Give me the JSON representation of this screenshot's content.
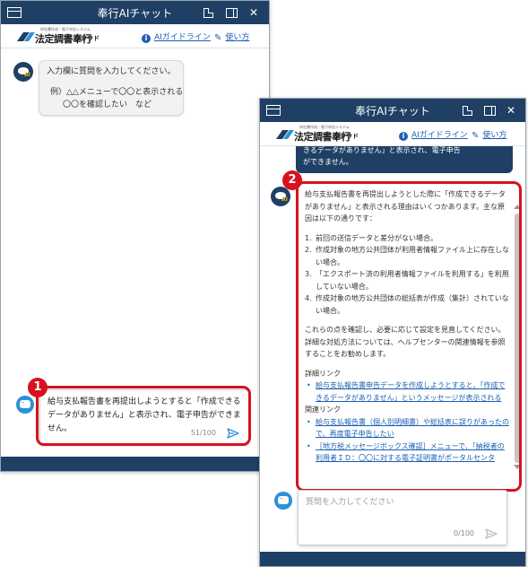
{
  "window1": {
    "title": "奉行AIチャット",
    "logo": {
      "sub": "申告書作成・電子申告システム",
      "main": "法定調書奉行",
      "cloud": "クラウド"
    },
    "links": {
      "guideline": "AIガイドライン",
      "howto": "使い方"
    },
    "bot_message": {
      "line1": "入力欄に質問を入力してください。",
      "line2": "例）△△メニューで〇〇と表示される",
      "line3": "〇〇を確認したい　など"
    },
    "composer": {
      "text": "給与支払報告書を再提出しようとすると「作成できるデータがありません」と表示され、電子申告ができません。",
      "counter": "51/100"
    },
    "badge": "1"
  },
  "window2": {
    "title": "奉行AIチャット",
    "logo": {
      "sub": "申告書作成・電子申告システム",
      "main": "法定調書奉行",
      "cloud": "クラウド"
    },
    "links": {
      "guideline": "AIガイドライン",
      "howto": "使い方"
    },
    "user_bubble_partial": {
      "line1": "きるデータがありません」と表示され、電子申告",
      "line2": "ができません。"
    },
    "answer": {
      "intro": "給与支払報告書を再提出しようとした際に「作成できるデータがありません」と表示される理由はいくつかあります。主な原因は以下の通りです：",
      "reasons": [
        {
          "n": "1.",
          "text": "前回の送信データと差分がない場合。"
        },
        {
          "n": "2.",
          "text": "作成対象の地方公共団体が利用者情報ファイル上に存在しない場合。"
        },
        {
          "n": "3.",
          "text": "「エクスポート済の利用者情報ファイルを利用する」を利用していない場合。"
        },
        {
          "n": "4.",
          "text": "作成対象の地方公共団体の総括表が作成（集計）されていない場合。"
        }
      ],
      "closing": "これらの点を確認し、必要に応じて設定を見直してください。詳細な対処方法については、ヘルプセンターの関連情報を参照することをお勧めします。",
      "detail_heading": "詳細リンク",
      "detail_link": "給与支払報告書申告データを作成しようとすると、「作成できるデータがありません」というメッセージが表示される",
      "related_heading": "関連リンク",
      "related_links": [
        "給与支払報告書（個人別明細書）や総括表に誤りがあったので、再度電子申告したい",
        "［地方税メッセージボックス確認］メニューで、「納税者の利用者ＩＤ：〇〇に対する電子証明書がポータルセンタ"
      ]
    },
    "composer": {
      "placeholder": "質問を入力してください",
      "counter": "0/100"
    },
    "badge": "2"
  },
  "colors": {
    "titlebar": "#1f3f64",
    "link": "#1a5fb4",
    "highlight": "#d8111e",
    "user_avatar": "#2b91d6"
  }
}
